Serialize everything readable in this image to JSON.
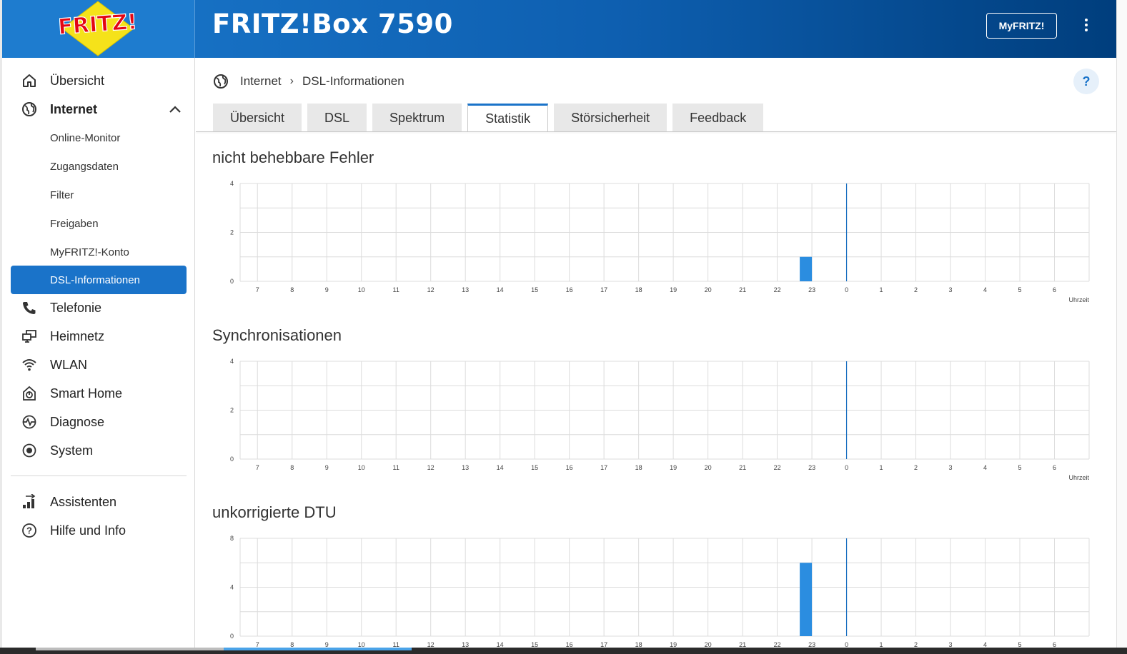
{
  "header": {
    "logo_text": "FRITZ!",
    "title": "FRITZ!Box 7590",
    "myfritz_label": "MyFRITZ!",
    "menu_icon": "more-vertical-icon"
  },
  "sidebar": {
    "items": [
      {
        "label": "Übersicht",
        "icon": "home-icon"
      },
      {
        "label": "Internet",
        "icon": "globe-icon",
        "expanded": true
      },
      {
        "label": "Telefonie",
        "icon": "phone-icon"
      },
      {
        "label": "Heimnetz",
        "icon": "network-icon"
      },
      {
        "label": "WLAN",
        "icon": "wifi-icon"
      },
      {
        "label": "Smart Home",
        "icon": "smart-home-icon"
      },
      {
        "label": "Diagnose",
        "icon": "diagnose-icon"
      },
      {
        "label": "System",
        "icon": "system-icon"
      }
    ],
    "internet_subitems": [
      {
        "label": "Online-Monitor"
      },
      {
        "label": "Zugangsdaten"
      },
      {
        "label": "Filter"
      },
      {
        "label": "Freigaben"
      },
      {
        "label": "MyFRITZ!-Konto"
      },
      {
        "label": "DSL-Informationen",
        "active": true
      }
    ],
    "bottom_items": [
      {
        "label": "Assistenten",
        "icon": "assistant-icon"
      },
      {
        "label": "Hilfe und Info",
        "icon": "help-circle-icon"
      }
    ]
  },
  "breadcrumb": {
    "parent": "Internet",
    "separator": "›",
    "current": "DSL-Informationen"
  },
  "help_label": "?",
  "tabs": [
    {
      "label": "Übersicht"
    },
    {
      "label": "DSL"
    },
    {
      "label": "Spektrum"
    },
    {
      "label": "Statistik",
      "active": true
    },
    {
      "label": "Störsicherheit"
    },
    {
      "label": "Feedback"
    }
  ],
  "colors": {
    "accent": "#1a73c9",
    "bar": "#2b8de0",
    "now_line": "#1a6fc0",
    "grid": "#dcdcdc"
  },
  "chart_data": [
    {
      "type": "bar",
      "title": "nicht behebbare Fehler",
      "xlabel": "Uhrzeit",
      "categories": [
        "7",
        "8",
        "9",
        "10",
        "11",
        "12",
        "13",
        "14",
        "15",
        "16",
        "17",
        "18",
        "19",
        "20",
        "21",
        "22",
        "23",
        "0",
        "1",
        "2",
        "3",
        "4",
        "5",
        "6"
      ],
      "yticks": [
        "0",
        "2",
        "4"
      ],
      "ylim": [
        0,
        4
      ],
      "bars": [
        {
          "hour": "23",
          "value": 1
        }
      ],
      "now_marker": "0",
      "grid": true
    },
    {
      "type": "bar",
      "title": "Synchronisationen",
      "xlabel": "Uhrzeit",
      "categories": [
        "7",
        "8",
        "9",
        "10",
        "11",
        "12",
        "13",
        "14",
        "15",
        "16",
        "17",
        "18",
        "19",
        "20",
        "21",
        "22",
        "23",
        "0",
        "1",
        "2",
        "3",
        "4",
        "5",
        "6"
      ],
      "yticks": [
        "0",
        "2",
        "4"
      ],
      "ylim": [
        0,
        4
      ],
      "bars": [],
      "now_marker": "0",
      "grid": true
    },
    {
      "type": "bar",
      "title": "unkorrigierte DTU",
      "xlabel": "",
      "categories": [
        "7",
        "8",
        "9",
        "10",
        "11",
        "12",
        "13",
        "14",
        "15",
        "16",
        "17",
        "18",
        "19",
        "20",
        "21",
        "22",
        "23",
        "0",
        "1",
        "2",
        "3",
        "4",
        "5",
        "6"
      ],
      "yticks": [
        "0",
        "4",
        "8"
      ],
      "ylim": [
        0,
        8
      ],
      "bars": [
        {
          "hour": "23",
          "value": 6
        }
      ],
      "now_marker": "0",
      "grid": true
    }
  ]
}
